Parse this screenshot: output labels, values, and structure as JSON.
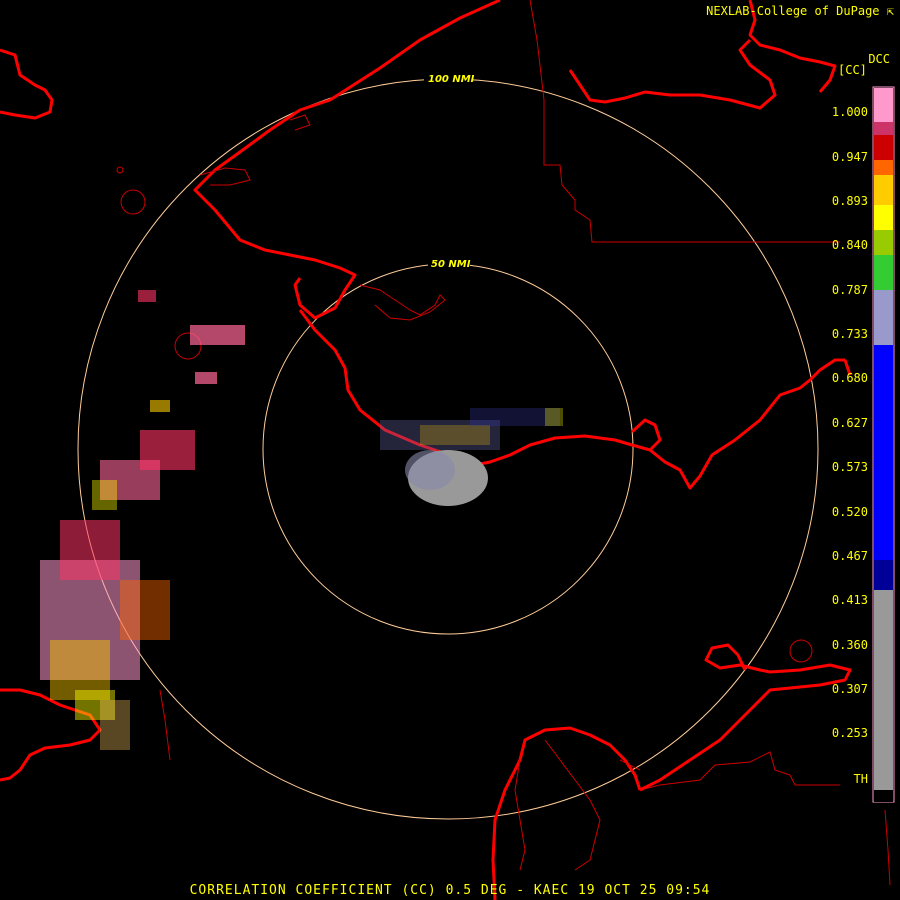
{
  "header": {
    "credit": "NEXLAB-College of DuPage",
    "product_code": "DCC",
    "unit": "[CC]"
  },
  "caption": "CORRELATION COEFFICIENT (CC) 0.5 DEG - KAEC 19 OCT 25 09:54",
  "range_rings": [
    {
      "label": "50 NMI"
    },
    {
      "label": "100 NMI"
    }
  ],
  "colorbar": {
    "ticks": [
      "1.000",
      "0.947",
      "0.893",
      "0.840",
      "0.787",
      "0.733",
      "0.680",
      "0.627",
      "0.573",
      "0.520",
      "0.467",
      "0.413",
      "0.360",
      "0.307",
      "0.253",
      "TH"
    ],
    "colors": [
      "#ff99cc",
      "#cc3366",
      "#cc0000",
      "#ff6600",
      "#ffcc00",
      "#ffff00",
      "#99cc00",
      "#33cc33",
      "#9999cc",
      "#0000ff",
      "#000099",
      "#999999",
      "#000000"
    ]
  },
  "icons": {
    "credit_icon": "cursor-arrow-icon"
  }
}
